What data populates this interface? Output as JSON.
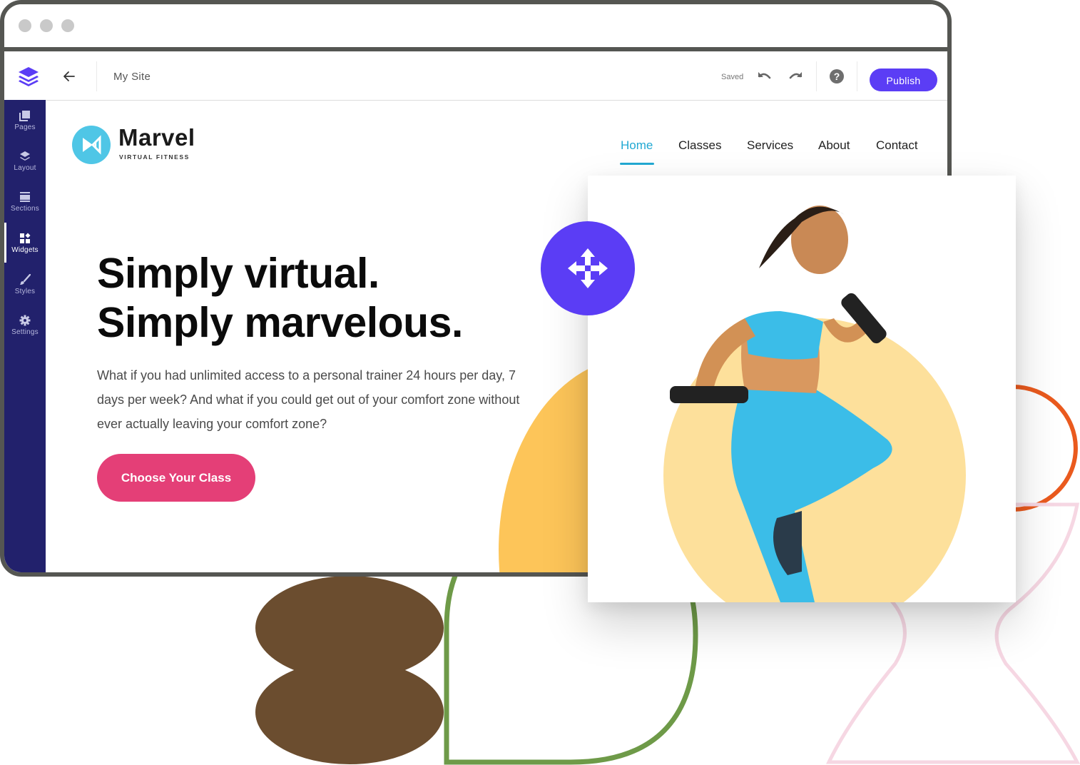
{
  "window": {
    "traffic_lights": [
      "close",
      "minimize",
      "maximize"
    ]
  },
  "toolbar": {
    "logo_icon": "layers-icon",
    "back_icon": "arrow-left-icon",
    "site_name": "My Site",
    "status": "Saved",
    "undo_icon": "undo-icon",
    "redo_icon": "redo-icon",
    "help_label": "?",
    "publish_label": "Publish",
    "accent_color": "#5b3df5"
  },
  "sidebar": {
    "active": "Widgets",
    "items": [
      {
        "label": "Pages",
        "icon": "pages-icon"
      },
      {
        "label": "Layout",
        "icon": "layout-icon"
      },
      {
        "label": "Sections",
        "icon": "sections-icon"
      },
      {
        "label": "Widgets",
        "icon": "widgets-icon"
      },
      {
        "label": "Styles",
        "icon": "brush-icon"
      },
      {
        "label": "Settings",
        "icon": "gear-icon"
      }
    ],
    "background_color": "#22216c"
  },
  "site": {
    "brand": {
      "name": "Marvel",
      "tagline": "VIRTUAL FITNESS",
      "color": "#4fc6e6"
    },
    "nav": {
      "active": "Home",
      "items": [
        "Home",
        "Classes",
        "Services",
        "About",
        "Contact"
      ],
      "active_color": "#22a9d3"
    },
    "hero": {
      "title_line1": "Simply virtual.",
      "title_line2": "Simply marvelous.",
      "body": "What if you had unlimited access to a personal trainer 24 hours per day, 7 days per week? And what if you could get out of your comfort zone without ever actually leaving your comfort zone?",
      "cta_label": "Choose Your Class",
      "cta_color": "#e43f77"
    },
    "image": {
      "alt": "Woman in blue sportswear running with dumbbells",
      "backdrop_color": "#fde09b"
    }
  },
  "move_handle": {
    "icon": "move-arrows-icon"
  },
  "decorations": {
    "colors": {
      "brown": "#6b4d2f",
      "green": "#6e9a48",
      "orange": "#ea5a1e",
      "pink": "#f6d7e3",
      "yellow": "#fdc559"
    }
  }
}
